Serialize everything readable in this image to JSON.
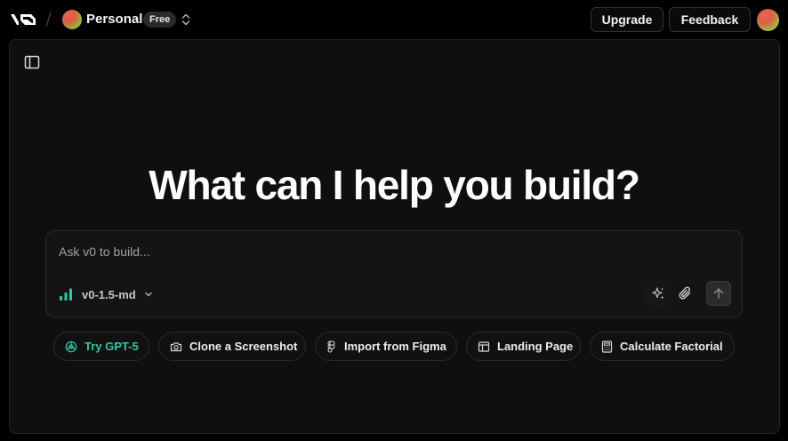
{
  "header": {
    "logo_text": "v0",
    "workspace_name": "Personal",
    "plan_badge": "Free",
    "upgrade_label": "Upgrade",
    "feedback_label": "Feedback"
  },
  "hero": {
    "title": "What can I help you build?"
  },
  "prompt": {
    "placeholder": "Ask v0 to build...",
    "value": "",
    "model": "v0-1.5-md"
  },
  "suggestions": [
    {
      "label": "Try GPT-5",
      "icon": "openai-icon"
    },
    {
      "label": "Clone a Screenshot",
      "icon": "camera-icon"
    },
    {
      "label": "Import from Figma",
      "icon": "figma-icon"
    },
    {
      "label": "Landing Page",
      "icon": "layout-icon"
    },
    {
      "label": "Calculate Factorial",
      "icon": "calculator-icon"
    }
  ],
  "colors": {
    "background": "#000000",
    "panel": "#0f0f0f",
    "accent_teal": "#2ec7a8"
  }
}
